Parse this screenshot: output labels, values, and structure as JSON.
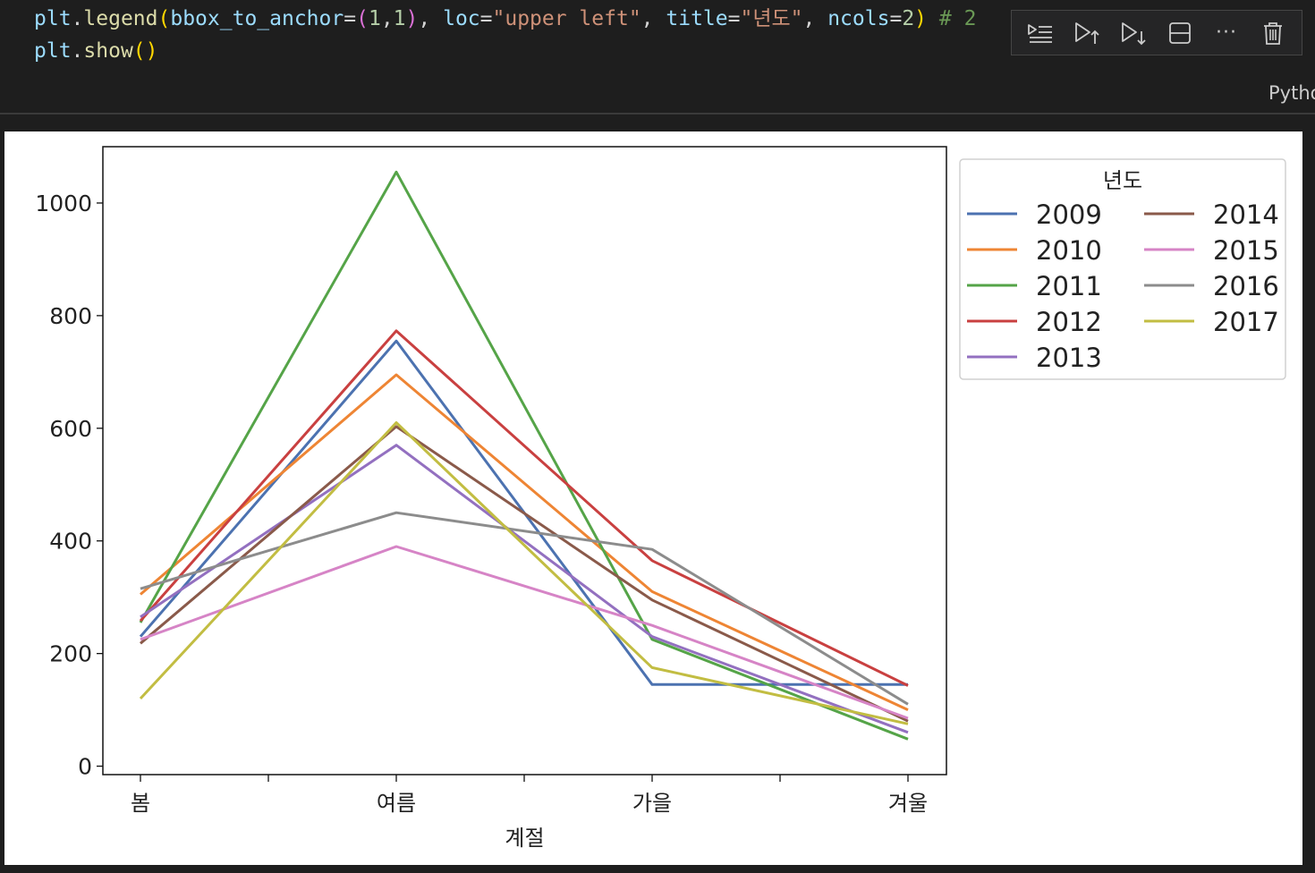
{
  "editor": {
    "line1": {
      "obj": "plt",
      "fn": "legend",
      "kw1": "bbox_to_anchor",
      "n1": "1",
      "n2": "1",
      "kw2": "loc",
      "s1": "\"upper left\"",
      "kw3": "title",
      "s2": "\"년도\"",
      "kw4": "ncols",
      "n3": "2",
      "comment": "# 2"
    },
    "line2": {
      "obj": "plt",
      "fn": "show"
    },
    "language": "Python"
  },
  "toolbar": {
    "buttons": [
      {
        "name": "execute-above-icon"
      },
      {
        "name": "run-above-icon"
      },
      {
        "name": "run-below-icon"
      },
      {
        "name": "split-cell-icon"
      },
      {
        "name": "more-icon"
      },
      {
        "name": "delete-icon"
      }
    ],
    "more_label": "···"
  },
  "chart_data": {
    "type": "line",
    "categories": [
      "봄",
      "여름",
      "가을",
      "겨울"
    ],
    "xlabel": "계절",
    "ylabel": "",
    "ylim": [
      -15,
      1100
    ],
    "yticks": [
      0,
      200,
      400,
      600,
      800,
      1000
    ],
    "grid": false,
    "legend": {
      "title": "년도",
      "placement": "outside-upper-left",
      "ncols": 2
    },
    "series": [
      {
        "name": "2009",
        "color": "#4c72b0",
        "values": [
          230,
          755,
          145,
          145
        ]
      },
      {
        "name": "2010",
        "color": "#ee8534",
        "values": [
          305,
          695,
          310,
          100
        ]
      },
      {
        "name": "2011",
        "color": "#55a448",
        "values": [
          255,
          1055,
          225,
          48
        ]
      },
      {
        "name": "2012",
        "color": "#c94040",
        "values": [
          258,
          773,
          365,
          143
        ]
      },
      {
        "name": "2013",
        "color": "#9370c0",
        "values": [
          265,
          570,
          230,
          60
        ]
      },
      {
        "name": "2014",
        "color": "#8a5a4a",
        "values": [
          218,
          603,
          295,
          80
        ]
      },
      {
        "name": "2015",
        "color": "#d684c6",
        "values": [
          225,
          390,
          250,
          85
        ]
      },
      {
        "name": "2016",
        "color": "#8c8c8c",
        "values": [
          315,
          450,
          385,
          110
        ]
      },
      {
        "name": "2017",
        "color": "#c2bd42",
        "values": [
          120,
          610,
          175,
          75
        ]
      }
    ]
  }
}
